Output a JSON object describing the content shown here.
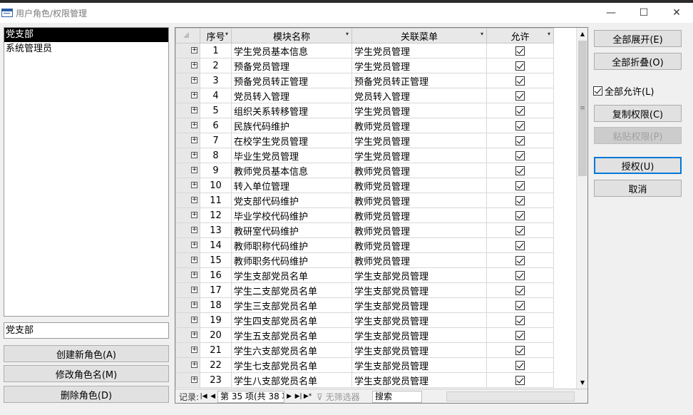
{
  "window": {
    "title": "用户角色/权限管理",
    "minimize": "—",
    "maximize": "☐",
    "close": "✕"
  },
  "roles": {
    "items": [
      "党支部",
      "系统管理员"
    ],
    "selected_index": 0,
    "name_value": "党支部",
    "create_label": "创建新角色(A)",
    "rename_label": "修改角色名(M)",
    "delete_label": "删除角色(D)"
  },
  "grid": {
    "headers": {
      "seq": "序号",
      "module": "模块名称",
      "menu": "关联菜单",
      "allow": "允许"
    },
    "rows": [
      {
        "seq": "1",
        "module": "学生党员基本信息",
        "menu": "学生党员管理",
        "allow": true,
        "indent": false
      },
      {
        "seq": "2",
        "module": "预备党员管理",
        "menu": "学生党员管理",
        "allow": true,
        "indent": false
      },
      {
        "seq": "3",
        "module": "预备党员转正管理",
        "menu": "预备党员转正管理",
        "allow": true,
        "indent": true
      },
      {
        "seq": "4",
        "module": "党员转入管理",
        "menu": "党员转入管理",
        "allow": true,
        "indent": true
      },
      {
        "seq": "5",
        "module": "组织关系转移管理",
        "menu": "学生党员管理",
        "allow": true,
        "indent": false
      },
      {
        "seq": "6",
        "module": "民族代码维护",
        "menu": "教师党员管理",
        "allow": true,
        "indent": false
      },
      {
        "seq": "7",
        "module": "在校学生党员管理",
        "menu": "学生党员管理",
        "allow": true,
        "indent": false
      },
      {
        "seq": "8",
        "module": "毕业生党员管理",
        "menu": "学生党员管理",
        "allow": true,
        "indent": false
      },
      {
        "seq": "9",
        "module": "教师党员基本信息",
        "menu": "教师党员管理",
        "allow": true,
        "indent": false
      },
      {
        "seq": "10",
        "module": "转入单位管理",
        "menu": "教师党员管理",
        "allow": true,
        "indent": false
      },
      {
        "seq": "11",
        "module": "党支部代码维护",
        "menu": "教师党员管理",
        "allow": true,
        "indent": false
      },
      {
        "seq": "12",
        "module": "毕业学校代码维护",
        "menu": "教师党员管理",
        "allow": true,
        "indent": false
      },
      {
        "seq": "13",
        "module": "教研室代码维护",
        "menu": "教师党员管理",
        "allow": true,
        "indent": false
      },
      {
        "seq": "14",
        "module": "教师职称代码维护",
        "menu": "教师党员管理",
        "allow": true,
        "indent": false
      },
      {
        "seq": "15",
        "module": "教师职务代码维护",
        "menu": "教师党员管理",
        "allow": true,
        "indent": false
      },
      {
        "seq": "16",
        "module": "学生支部党员名单",
        "menu": "学生支部党员管理",
        "allow": true,
        "indent": false
      },
      {
        "seq": "17",
        "module": "学生二支部党员名单",
        "menu": "学生支部党员管理",
        "allow": true,
        "indent": false
      },
      {
        "seq": "18",
        "module": "学生三支部党员名单",
        "menu": "学生支部党员管理",
        "allow": true,
        "indent": false
      },
      {
        "seq": "19",
        "module": "学生四支部党员名单",
        "menu": "学生支部党员管理",
        "allow": true,
        "indent": false
      },
      {
        "seq": "20",
        "module": "学生五支部党员名单",
        "menu": "学生支部党员管理",
        "allow": true,
        "indent": false
      },
      {
        "seq": "21",
        "module": "学生六支部党员名单",
        "menu": "学生支部党员管理",
        "allow": true,
        "indent": false
      },
      {
        "seq": "22",
        "module": "学生七支部党员名单",
        "menu": "学生支部党员管理",
        "allow": true,
        "indent": false
      },
      {
        "seq": "23",
        "module": "学生八支部党员名单",
        "menu": "学生支部党员管理",
        "allow": true,
        "indent": false
      }
    ],
    "nav": {
      "label": "记录:",
      "record_text": "第 35 项(共 38 项)",
      "filter_label": "无筛选器",
      "search_placeholder": "搜索"
    }
  },
  "actions": {
    "expand_all": "全部展开(E)",
    "collapse_all": "全部折叠(O)",
    "allow_all_label": "全部允许(L)",
    "allow_all_checked": true,
    "copy": "复制权限(C)",
    "paste": "粘贴权限(P)",
    "grant": "授权(U)",
    "cancel": "取消"
  }
}
